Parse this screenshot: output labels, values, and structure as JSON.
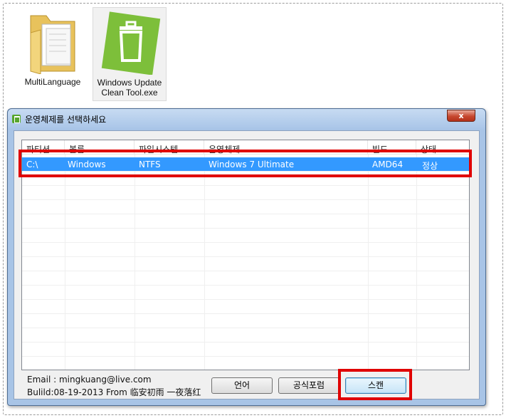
{
  "desktop": {
    "icons": [
      {
        "label": "MultiLanguage",
        "icon": "folder-icon"
      },
      {
        "label_line1": "Windows Update",
        "label_line2": "Clean Tool.exe",
        "icon": "trash-app-icon"
      }
    ]
  },
  "dialog": {
    "title": "운영체제를 선택하세요",
    "close_glyph": "x",
    "columns": [
      "파티션",
      "볼륨",
      "파일시스템",
      "운영체제",
      "빌드",
      "상태"
    ],
    "rows": [
      {
        "partition": "C:\\",
        "volume": "Windows",
        "filesystem": "NTFS",
        "os": "Windows 7 Ultimate",
        "build": "AMD64",
        "status": "정상",
        "selected": true
      }
    ],
    "footer": {
      "email": "Email : mingkuang@live.com",
      "build": "Bulild:08-19-2013 From 临安初雨 一夜落红"
    },
    "buttons": {
      "language": "언어",
      "forum": "공식포럼",
      "scan": "스캔"
    }
  },
  "colors": {
    "selection": "#3399ff",
    "highlight": "#e00000",
    "app_icon_green": "#7dbf3a"
  }
}
